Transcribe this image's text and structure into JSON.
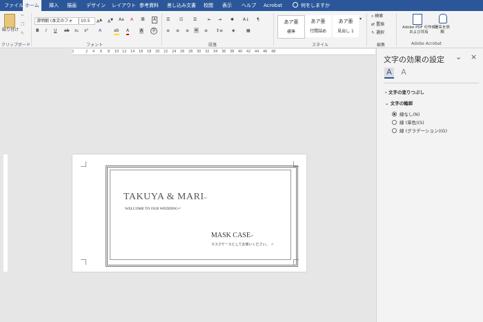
{
  "tabs": [
    "ファイル",
    "ホーム",
    "挿入",
    "描画",
    "デザイン",
    "レイアウト",
    "参考資料",
    "差し込み文書",
    "校閲",
    "表示",
    "ヘルプ",
    "Acrobat"
  ],
  "tell_me": "何をしますか",
  "ribbon": {
    "clipboard": {
      "paste_label": "貼り付け",
      "group_label": "クリップボード"
    },
    "font": {
      "font_name": "游明朝 (本文のフォ",
      "font_size": "10.5",
      "group_label": "フォント"
    },
    "paragraph": {
      "group_label": "段落"
    },
    "styles": {
      "items": [
        "標準",
        "行間詰め",
        "見出し 1"
      ],
      "preview": "あア亜",
      "group_label": "スタイル"
    },
    "editing": {
      "search": "検索",
      "replace": "置換",
      "select": "選択",
      "group_label": "編集"
    },
    "acrobat": {
      "create_share": "Adobe PDF の作成および共有",
      "sign_request": "署名を依頼",
      "group_label": "Adobe Acrobat"
    }
  },
  "ruler_numbers": [
    "2",
    "2",
    "4",
    "6",
    "8",
    "10",
    "12",
    "14",
    "16",
    "18",
    "20",
    "22",
    "24",
    "26",
    "28",
    "30",
    "32",
    "34",
    "36",
    "38",
    "40",
    "42",
    "44",
    "46",
    "48"
  ],
  "document": {
    "title": "TAKUYA & MARI",
    "subtitle": "WELCOME TO OUR WEDDING",
    "mask_case": "MASK CASE",
    "mask_note": "マスクケースとしてお使いください。",
    "para_mark": "↵"
  },
  "pane": {
    "title": "文字の効果の設定",
    "section_fill": "文字の塗りつぶし",
    "section_outline": "文字の輪郭",
    "options": [
      "線なし(N)",
      "線 (単色)(S)",
      "線 (グラデーション)(G)"
    ],
    "selected_option": 0
  },
  "colors": {
    "accent": "#2b579a",
    "ribbon_bg": "#f3f3f3",
    "canvas_bg": "#e6e6e6"
  }
}
